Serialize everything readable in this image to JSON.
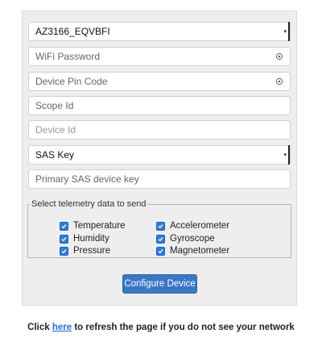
{
  "form": {
    "network_select": {
      "value": "AZ3166_EQVBFI"
    },
    "wifi_password": {
      "placeholder": "WiFi Password",
      "icon": "eye-icon"
    },
    "device_pin": {
      "placeholder": "Device Pin Code",
      "icon": "eye-icon"
    },
    "scope_id": {
      "placeholder": "Scope Id"
    },
    "device_id": {
      "placeholder": "Device Id"
    },
    "auth_select": {
      "value": "SAS Key"
    },
    "sas_key": {
      "placeholder": "Primary SAS device key"
    }
  },
  "telemetry": {
    "legend": "Select telemetry data to send",
    "left": [
      {
        "label": "Temperature",
        "checked": true
      },
      {
        "label": "Humidity",
        "checked": true
      },
      {
        "label": "Pressure",
        "checked": true
      }
    ],
    "right": [
      {
        "label": "Accelerometer",
        "checked": true
      },
      {
        "label": "Gyroscope",
        "checked": true
      },
      {
        "label": "Magnetometer",
        "checked": true
      }
    ]
  },
  "button": {
    "label": "Configure Device"
  },
  "footer": {
    "prefix": "Click ",
    "link_text": "here",
    "suffix": " to refresh the page if you do not see your network"
  },
  "colors": {
    "accent": "#3a78c5",
    "checkbox": "#2f7bd9",
    "link": "#2a6bd1"
  }
}
